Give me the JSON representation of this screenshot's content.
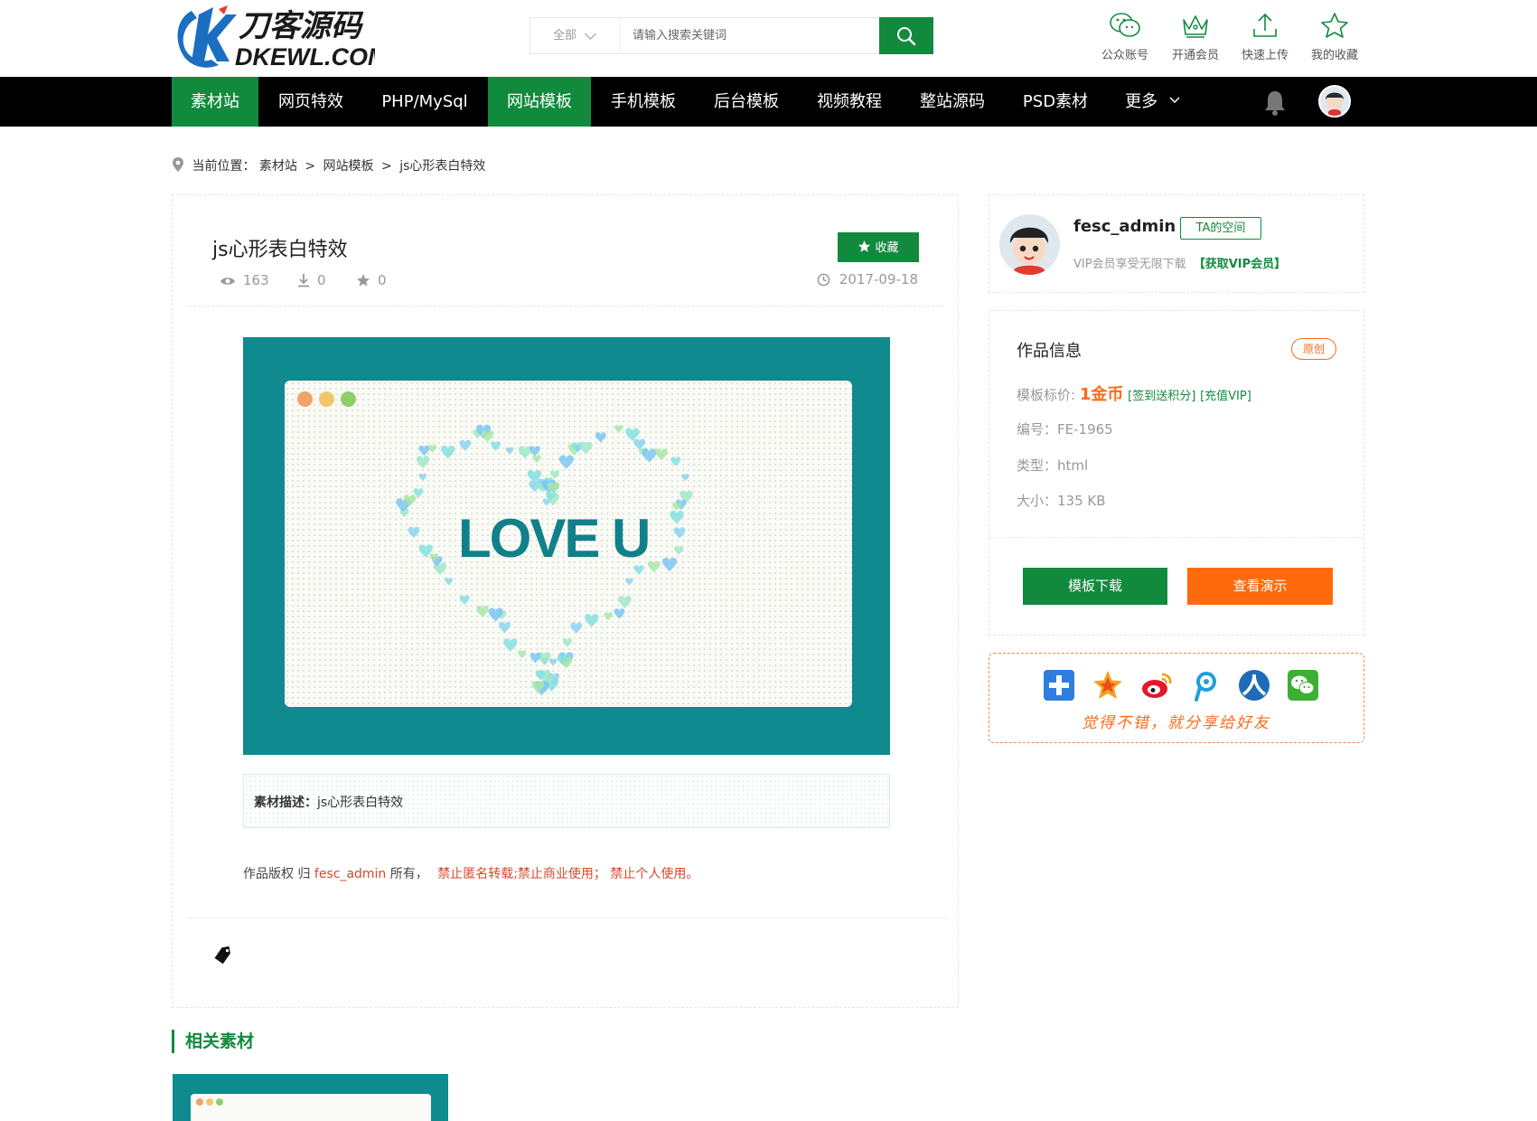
{
  "header": {
    "logo_text": "刀客源码",
    "logo_sub": "DKEWL.COM",
    "search": {
      "category": "全部",
      "placeholder": "请输入搜索关键词"
    },
    "links": [
      {
        "label": "公众账号",
        "icon": "wechat-bubble-icon"
      },
      {
        "label": "开通会员",
        "icon": "crown-icon"
      },
      {
        "label": "快速上传",
        "icon": "upload-icon"
      },
      {
        "label": "我的收藏",
        "icon": "star-icon"
      }
    ]
  },
  "nav": {
    "items": [
      {
        "label": "素材站",
        "active": true
      },
      {
        "label": "网页特效",
        "active": false
      },
      {
        "label": "PHP/MySql",
        "active": false
      },
      {
        "label": "网站模板",
        "active": true
      },
      {
        "label": "手机模板",
        "active": false
      },
      {
        "label": "后台模板",
        "active": false
      },
      {
        "label": "视频教程",
        "active": false
      },
      {
        "label": "整站源码",
        "active": false
      },
      {
        "label": "PSD素材",
        "active": false
      },
      {
        "label": "更多",
        "active": false
      }
    ]
  },
  "breadcrumb": {
    "prefix": "当前位置：",
    "parts": [
      "素材站",
      "网站模板",
      "js心形表白特效"
    ],
    "separator": ">"
  },
  "article": {
    "title": "js心形表白特效",
    "views": "163",
    "downloads": "0",
    "favorites": "0",
    "fav_button": "收藏",
    "date": "2017-09-18",
    "preview_text": "LOVE U",
    "description_label": "素材描述：",
    "description": "js心形表白特效",
    "copyright_prefix": "作品版权 归",
    "copyright_owner": "fesc_admin",
    "copyright_mid": "所有，",
    "copyright_rules": "禁止匿名转载;禁止商业使用；  禁止个人使用。"
  },
  "related": {
    "title": "相关素材"
  },
  "author": {
    "name": "fesc_admin",
    "space_button": "TA的空间",
    "vip_text": "VIP会员享受无限下载",
    "vip_link": "【获取VIP会员】"
  },
  "info": {
    "title": "作品信息",
    "badge": "原创",
    "price_label": "模板标价:",
    "price": "1金币",
    "price_link1": "[签到送积分]",
    "price_link2": "[充值VIP]",
    "code_label": "编号：",
    "code": "FE-1965",
    "type_label": "类型：",
    "type": "html",
    "size_label": "大小：",
    "size": "135 KB",
    "download_button": "模板下载",
    "demo_button": "查看演示"
  },
  "share": {
    "text": "觉得不错，就分享给好友",
    "icons": [
      "share-plus-icon",
      "qzone-star-icon",
      "weibo-icon",
      "tencent-weibo-icon",
      "renren-icon",
      "wechat-icon"
    ]
  },
  "colors": {
    "brand_green": "#128a3e",
    "accent_orange": "#ff6a1a",
    "nav_bg": "#000000",
    "preview_teal": "#0f8a8f"
  }
}
